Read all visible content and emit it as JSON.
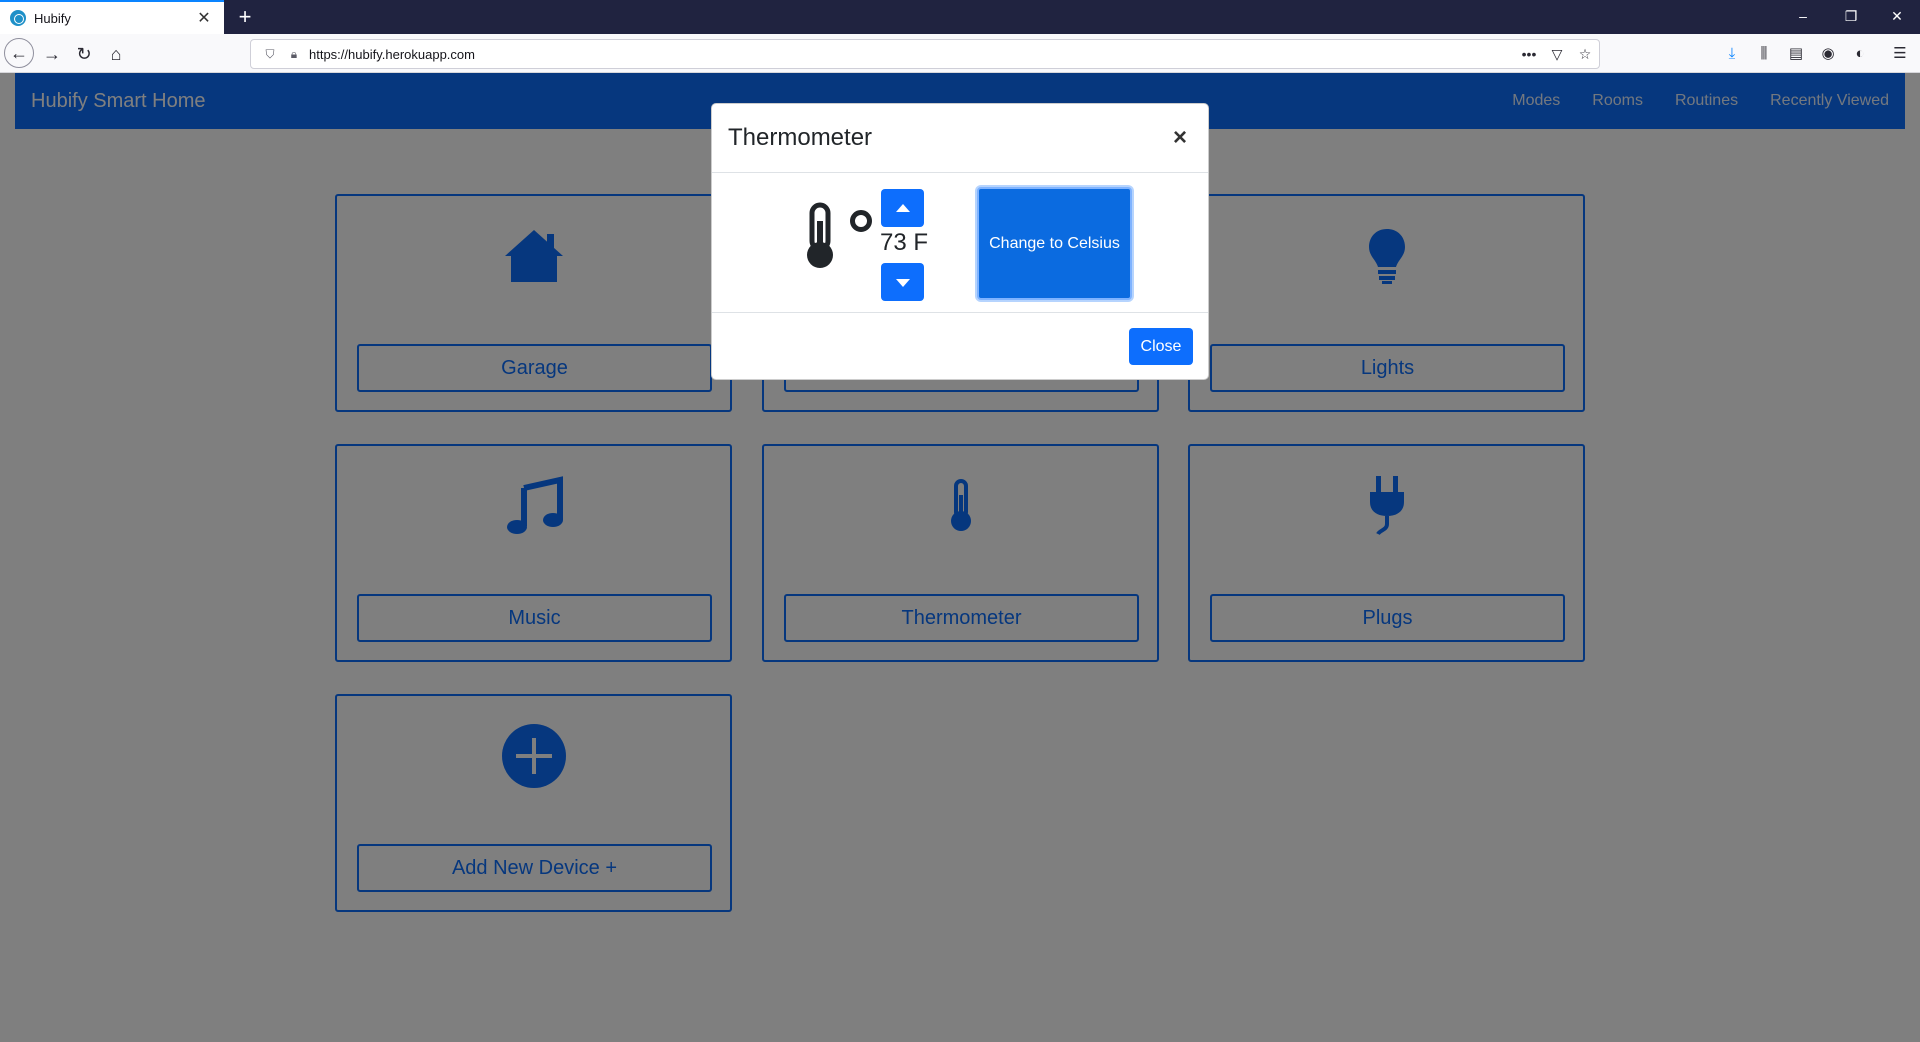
{
  "browser": {
    "tab_title": "Hubify",
    "tab_close": "✕",
    "new_tab": "+",
    "url": "https://hubify.herokuapp.com",
    "window_controls": {
      "minimize": "–",
      "restore": "❐",
      "close": "✕"
    }
  },
  "app": {
    "brand": "Hubify Smart Home",
    "nav_links": [
      "Modes",
      "Rooms",
      "Routines",
      "Recently Viewed"
    ],
    "devices": [
      {
        "label": "Garage",
        "icon": "home-icon"
      },
      {
        "label": "",
        "icon": ""
      },
      {
        "label": "Lights",
        "icon": "lightbulb-icon"
      },
      {
        "label": "Music",
        "icon": "music-icon"
      },
      {
        "label": "Thermometer",
        "icon": "thermometer-icon"
      },
      {
        "label": "Plugs",
        "icon": "plug-icon"
      },
      {
        "label": "Add New Device +",
        "icon": "plus-circle-icon"
      }
    ],
    "accent_color": "#0d6efd"
  },
  "modal": {
    "title": "Thermometer",
    "close_x": "×",
    "temperature": "73 F",
    "unit_button": "Change to Celsius",
    "close_button": "Close"
  }
}
